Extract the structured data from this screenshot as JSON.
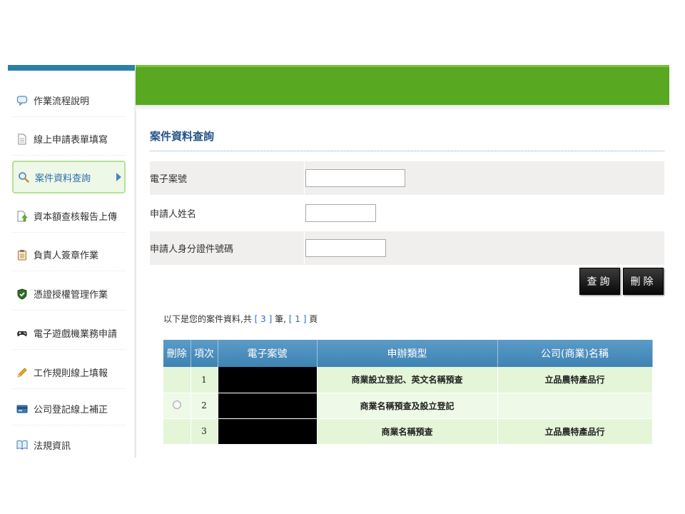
{
  "sidebar": {
    "items": [
      {
        "label": "作業流程說明",
        "icon": "chat-bubble-icon"
      },
      {
        "label": "線上申請表單填寫",
        "icon": "document-icon"
      },
      {
        "label": "案件資料查詢",
        "icon": "magnifier-icon",
        "active": true
      },
      {
        "label": "資本額查核報告上傳",
        "icon": "upload-document-icon"
      },
      {
        "label": "負責人簽章作業",
        "icon": "clipboard-icon"
      },
      {
        "label": "憑證授權管理作業",
        "icon": "shield-check-icon"
      },
      {
        "label": "電子遊戲機業務申請",
        "icon": "gamepad-icon"
      },
      {
        "label": "工作規則線上填報",
        "icon": "pencil-icon"
      },
      {
        "label": "公司登記線上補正",
        "icon": "card-icon"
      },
      {
        "label": "法規資訊",
        "icon": "book-icon"
      }
    ]
  },
  "main": {
    "title": "案件資料查詢",
    "form": {
      "case_no_label": "電子案號",
      "applicant_name_label": "申請人姓名",
      "applicant_id_label": "申請人身分證件號碼",
      "case_no_value": "",
      "applicant_name_value": "",
      "applicant_id_value": ""
    },
    "buttons": {
      "query": "查詢",
      "delete": "刪除"
    },
    "summary": {
      "prefix": "以下是您的案件資料,共",
      "count": "[ 3 ]",
      "mid": "筆,",
      "pages": "[ 1 ]",
      "suffix": "頁"
    },
    "table": {
      "headers": [
        "刪除",
        "項次",
        "電子案號",
        "申辦類型",
        "公司(商業)名稱"
      ],
      "rows": [
        {
          "index": "1",
          "case_no": "",
          "type": "商業設立登記、英文名稱預查",
          "company": "立品農特產品行",
          "deletable": false
        },
        {
          "index": "2",
          "case_no": "",
          "type": "商業名稱預查及設立登記",
          "company": "",
          "deletable": true
        },
        {
          "index": "3",
          "case_no": "",
          "type": "商業名稱預查",
          "company": "立品農特產品行",
          "deletable": false
        }
      ]
    }
  },
  "colors": {
    "header_green": "#58a821",
    "sidebar_accent": "#2d7fa8",
    "title_blue": "#25558a",
    "table_header": "#4a8dbd",
    "row_green": "#e4f5d8"
  }
}
